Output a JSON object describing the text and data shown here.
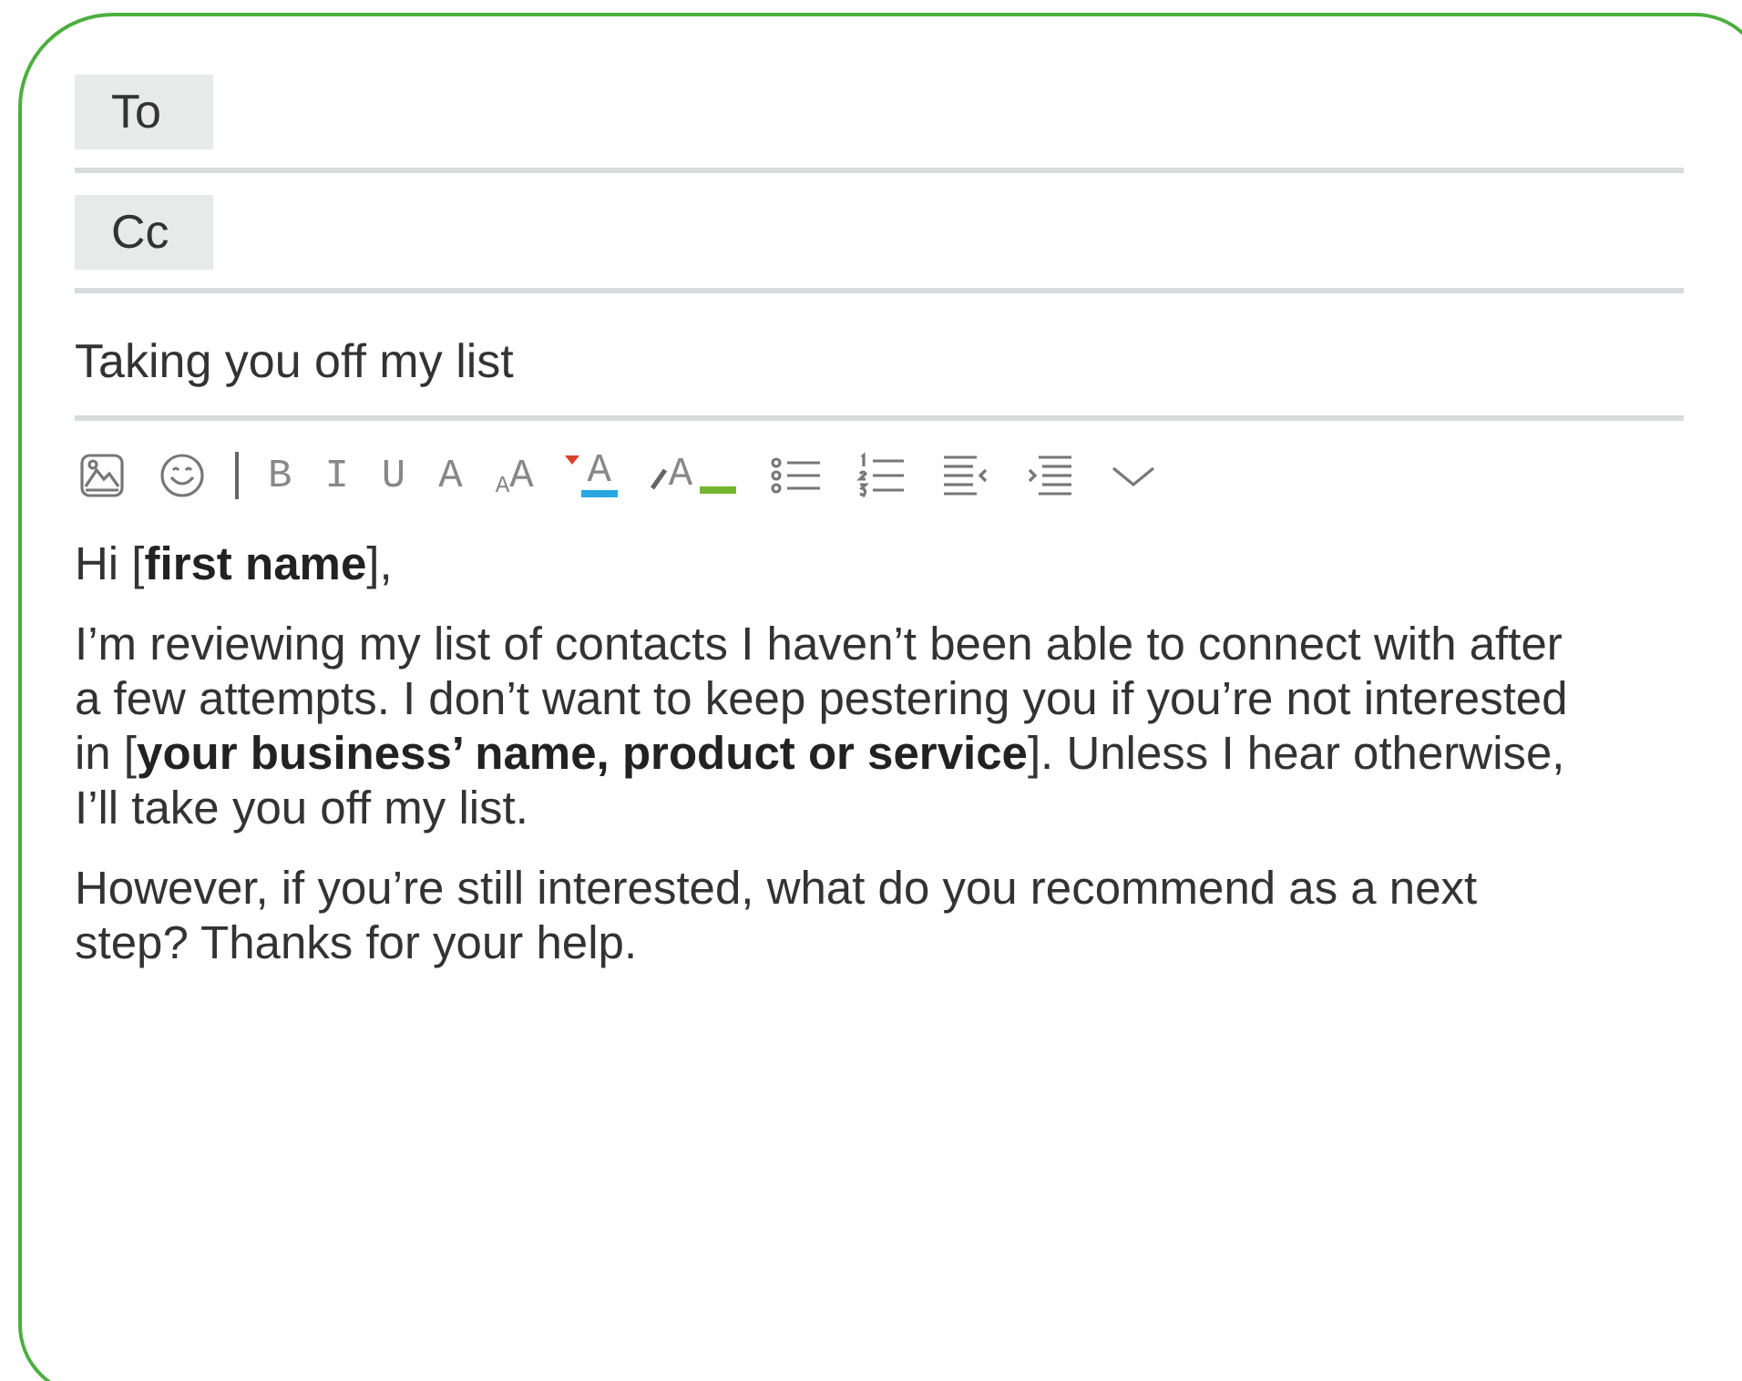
{
  "recipients": [
    {
      "label": "To"
    },
    {
      "label": "Cc"
    }
  ],
  "subject": {
    "value": "Taking you off my list"
  },
  "toolbar": {
    "format_buttons": [
      "B",
      "I",
      "U",
      "A"
    ],
    "font_size": [
      "A",
      "A"
    ],
    "font_color": "A",
    "highlight": "A"
  },
  "body": {
    "greeting": "Hi [**first name**],",
    "paragraphs": [
      "I’m reviewing my list of contacts I haven’t been able to connect with after a few attempts. I don’t want to keep pestering you if you’re not interested in [**your business’ name, product or service**]. Unless I hear otherwise, I’ll take you off my list.",
      "However, if you’re still interested, what do you recommend as a next step? Thanks for your help."
    ]
  }
}
